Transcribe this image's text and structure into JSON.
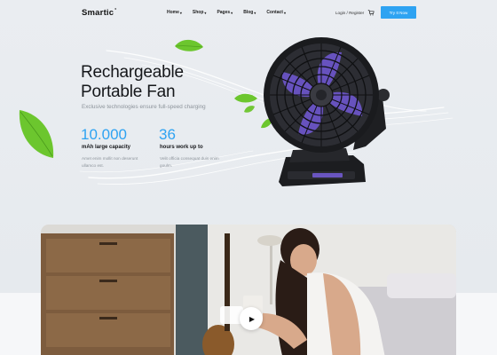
{
  "header": {
    "logo": "Smartic",
    "logo_mark": "°",
    "nav": [
      {
        "label": "Home",
        "caret": "▾"
      },
      {
        "label": "Shop",
        "caret": "▾"
      },
      {
        "label": "Pages",
        "caret": "▾"
      },
      {
        "label": "Blog",
        "caret": "▾"
      },
      {
        "label": "Contact",
        "caret": "▾"
      }
    ],
    "login": "Login / Register",
    "cart_icon": "cart-icon",
    "cta": "Try It Now"
  },
  "hero": {
    "title_line1": "Rechargeable",
    "title_line2": "Portable Fan",
    "subtitle": "Exclusive technologies ensure full-speed charging",
    "stats": [
      {
        "value": "10.000",
        "label": "mAh large capacity",
        "desc": "Amet enim mollit non deserunt ullamco est."
      },
      {
        "value": "36",
        "label": "hours work up to",
        "desc": "Velit officia consequat duis enim goulm."
      }
    ]
  },
  "video": {
    "play_icon": "play-icon",
    "play_glyph": "▶"
  },
  "colors": {
    "accent": "#2ea3f2",
    "background": "#eaedf1",
    "leaf": "#6cc62e"
  }
}
